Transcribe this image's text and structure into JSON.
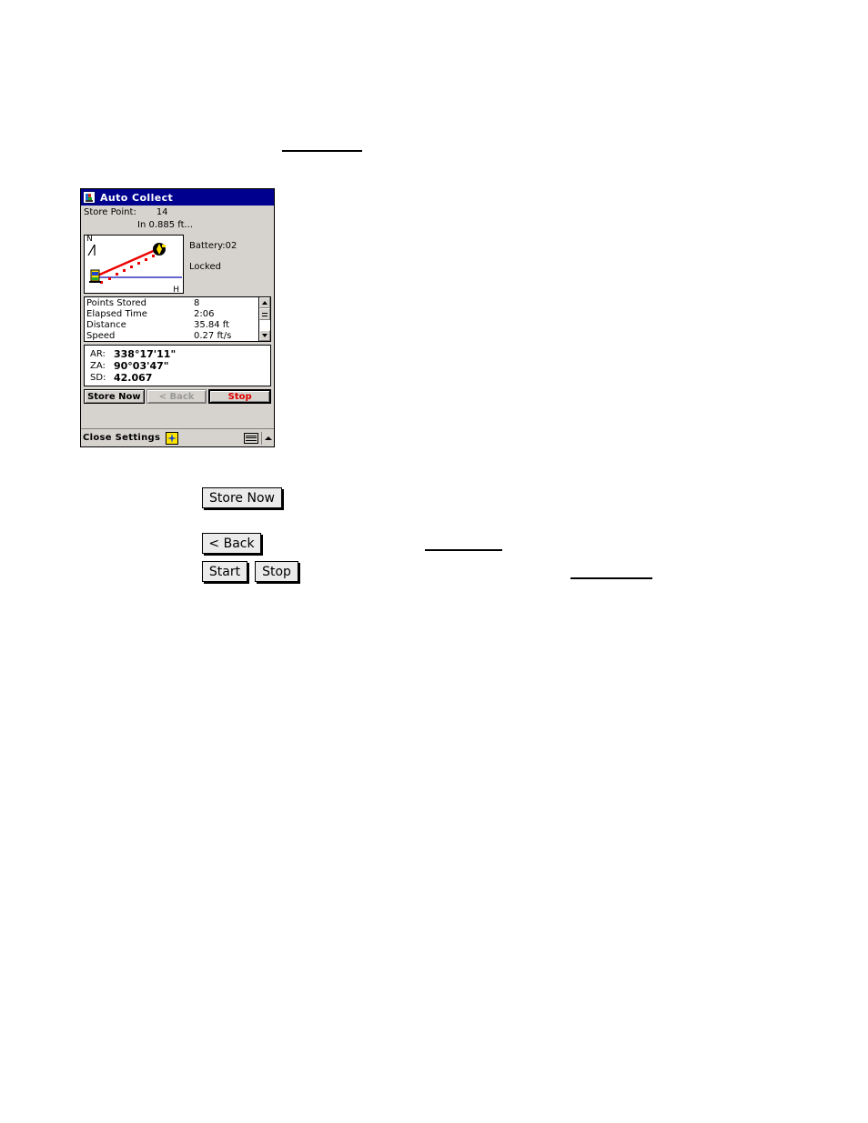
{
  "window": {
    "title": "Auto Collect",
    "title_icon": "survey-instrument-icon",
    "store_point_label": "Store Point:",
    "store_point_value": "14",
    "in_range_text": "In 0.885 ft...",
    "graphic": {
      "north_label": "N",
      "horizontal_label": "H",
      "instrument_icon": "total-station-icon",
      "target_icon": "prism-target-icon"
    },
    "status": {
      "battery": "Battery:02",
      "lock": "Locked"
    },
    "stats": [
      {
        "name": "Points Stored",
        "value": "8"
      },
      {
        "name": "Elapsed Time",
        "value": "2:06"
      },
      {
        "name": "Distance",
        "value": "35.84 ft"
      },
      {
        "name": "Speed",
        "value": "0.27 ft/s"
      }
    ],
    "measurements": [
      {
        "label": "AR:",
        "value": "338°17'11\""
      },
      {
        "label": "ZA:",
        "value": "90°03'47\""
      },
      {
        "label": "SD:",
        "value": "42.067"
      }
    ],
    "actions": {
      "store_now": "Store Now",
      "back": "< Back",
      "stop": "Stop"
    },
    "taskbar": {
      "close_settings": "Close Settings",
      "star_icon": "star-icon",
      "keyboard_icon": "keyboard-icon",
      "caret_icon": "caret-up-icon"
    }
  },
  "document_figures": {
    "store_now_button": "Store Now",
    "back_button": "< Back",
    "start_button": "Start",
    "stop_button": "Stop"
  },
  "colors": {
    "titlebar": "#00008f",
    "window_face": "#d6d3ce",
    "stop_red": "#e00000",
    "path_red": "#ee0000",
    "horizon_blue": "#3333bb",
    "star_yellow": "#ffe400"
  }
}
